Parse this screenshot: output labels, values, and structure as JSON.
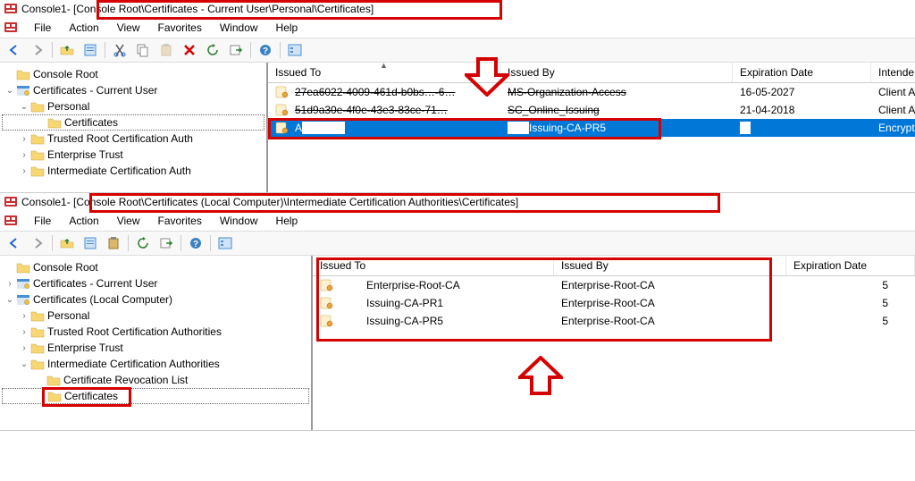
{
  "window1": {
    "title_prefix": "Console1",
    "title_path": " - [Console Root\\Certificates - Current User\\Personal\\Certificates]",
    "menu": [
      "File",
      "Action",
      "View",
      "Favorites",
      "Window",
      "Help"
    ],
    "tree": {
      "root": "Console Root",
      "n1": "Certificates - Current User",
      "n1_1": "Personal",
      "n1_1_1": "Certificates",
      "n1_2": "Trusted Root Certification Auth",
      "n1_3": "Enterprise Trust",
      "n1_4": "Intermediate Certification Auth"
    },
    "columns": {
      "issued_to": "Issued To",
      "issued_by": "Issued By",
      "expiration": "Expiration Date",
      "intended": "Intende"
    },
    "rows": [
      {
        "issued_to": "27ea6022-4009-461d-b0bs…-6…",
        "issued_by": "MS-Organization-Access",
        "exp": "16-05-2027",
        "intended": "Client A",
        "strike": true
      },
      {
        "issued_to": "51d9a30e-4f0e-43e3-83ce-71…",
        "issued_by": "SC_Online_Issuing",
        "exp": "21-04-2018",
        "intended": "Client A",
        "strike": true
      },
      {
        "issued_to": "A",
        "issued_by": "Issuing-CA-PR5",
        "exp": " ",
        "intended": "Encrypt",
        "selected": true
      }
    ]
  },
  "window2": {
    "title_prefix": "Console1",
    "title_path": " - [Console Root\\Certificates (Local Computer)\\Intermediate Certification Authorities\\Certificates]",
    "menu": [
      "File",
      "Action",
      "View",
      "Favorites",
      "Window",
      "Help"
    ],
    "tree": {
      "root": "Console Root",
      "n1": "Certificates - Current User",
      "n2": "Certificates (Local Computer)",
      "n2_1": "Personal",
      "n2_2": "Trusted Root Certification Authorities",
      "n2_3": "Enterprise Trust",
      "n2_4": "Intermediate Certification Authorities",
      "n2_4_1": "Certificate Revocation List",
      "n2_4_2": "Certificates"
    },
    "columns": {
      "issued_to": "Issued To",
      "issued_by": "Issued By",
      "expiration": "Expiration Date"
    },
    "rows": [
      {
        "issued_to": "Enterprise-Root-CA",
        "issued_by": "Enterprise-Root-CA",
        "exp": "5"
      },
      {
        "issued_to": "Issuing-CA-PR1",
        "issued_by": "Enterprise-Root-CA",
        "exp": "5"
      },
      {
        "issued_to": "Issuing-CA-PR5",
        "issued_by": "Enterprise-Root-CA",
        "exp": "5"
      }
    ]
  }
}
